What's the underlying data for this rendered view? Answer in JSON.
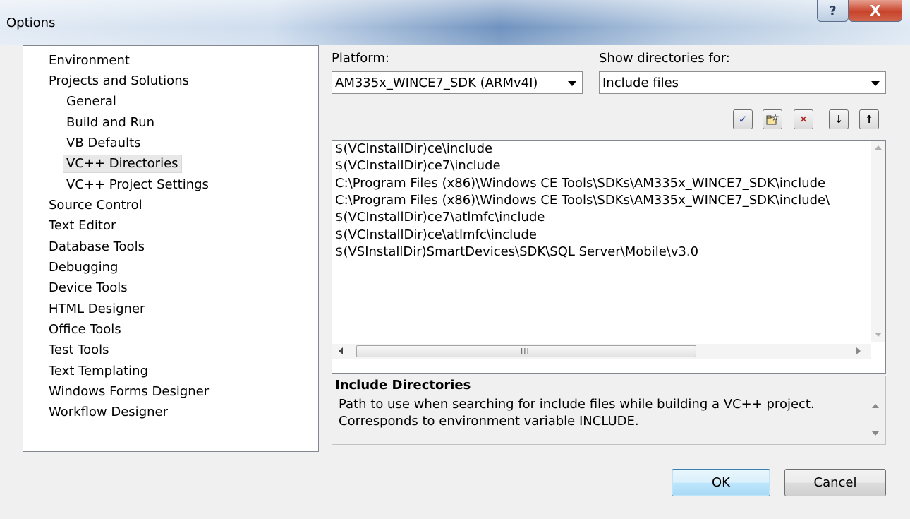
{
  "window": {
    "title": "Options",
    "help_glyph": "?",
    "close_glyph": "X",
    "accent": "#3c7fb1"
  },
  "tree": {
    "items": [
      {
        "label": "Environment"
      },
      {
        "label": "Projects and Solutions"
      },
      {
        "label": "General"
      },
      {
        "label": "Build and Run"
      },
      {
        "label": "VB Defaults"
      },
      {
        "label": "VC++ Directories",
        "selected": true
      },
      {
        "label": "VC++ Project Settings"
      },
      {
        "label": "Source Control"
      },
      {
        "label": "Text Editor"
      },
      {
        "label": "Database Tools"
      },
      {
        "label": "Debugging"
      },
      {
        "label": "Device Tools"
      },
      {
        "label": "HTML Designer"
      },
      {
        "label": "Office Tools"
      },
      {
        "label": "Test Tools"
      },
      {
        "label": "Text Templating"
      },
      {
        "label": "Windows Forms Designer"
      },
      {
        "label": "Workflow Designer"
      }
    ]
  },
  "platform": {
    "label": "Platform:",
    "value": "AM335x_WINCE7_SDK (ARMv4I)"
  },
  "show_dirs": {
    "label": "Show directories for:",
    "value": "Include files"
  },
  "toolbar": {
    "check_glyph": "✓",
    "new_folder_glyph": "▭",
    "delete_glyph": "✕",
    "down_glyph": "↓",
    "up_glyph": "↑"
  },
  "directories": [
    "$(VCInstallDir)ce\\include",
    "$(VCInstallDir)ce7\\include",
    "C:\\Program Files (x86)\\Windows CE Tools\\SDKs\\AM335x_WINCE7_SDK\\include",
    "C:\\Program Files (x86)\\Windows CE Tools\\SDKs\\AM335x_WINCE7_SDK\\include\\",
    "$(VCInstallDir)ce7\\atlmfc\\include",
    "$(VCInstallDir)ce\\atlmfc\\include",
    "$(VSInstallDir)SmartDevices\\SDK\\SQL Server\\Mobile\\v3.0"
  ],
  "scroll": {
    "grip": "III"
  },
  "description": {
    "title": "Include Directories",
    "line1": "Path to use when searching for include files while building a VC++ project.",
    "line2": "Corresponds to environment variable INCLUDE."
  },
  "buttons": {
    "ok": "OK",
    "cancel": "Cancel"
  }
}
